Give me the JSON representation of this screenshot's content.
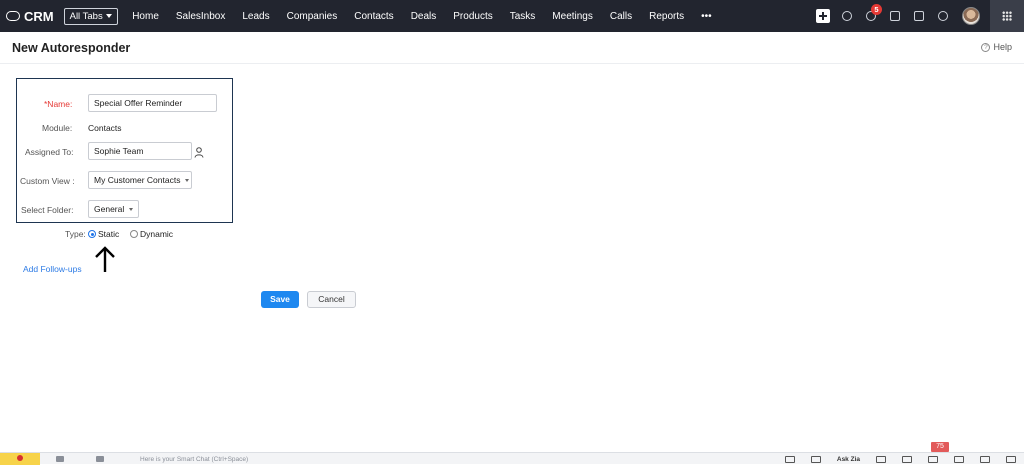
{
  "nav": {
    "brand": "CRM",
    "all_tabs": "All Tabs",
    "items": [
      "Home",
      "SalesInbox",
      "Leads",
      "Companies",
      "Contacts",
      "Deals",
      "Products",
      "Tasks",
      "Meetings",
      "Calls",
      "Reports",
      "•••"
    ],
    "notification_count": "5"
  },
  "page": {
    "title": "New Autoresponder",
    "help": "Help"
  },
  "form": {
    "name_label": "*Name:",
    "name_value": "Special Offer Reminder",
    "module_label": "Module:",
    "module_value": "Contacts",
    "assigned_label": "Assigned To:",
    "assigned_value": "Sophie Team",
    "view_label": "Custom View :",
    "view_value": "My Customer Contacts",
    "folder_label": "Select Folder:",
    "folder_value": "General",
    "type_label": "Type:",
    "type_options": [
      "Static",
      "Dynamic"
    ],
    "type_selected": "Static",
    "add_followups": "Add Follow-ups"
  },
  "actions": {
    "save": "Save",
    "cancel": "Cancel"
  },
  "bottombar": {
    "chat_placeholder": "Here is your Smart Chat (Ctrl+Space)",
    "ask_zia": "Ask Zia",
    "count": "75"
  },
  "colors": {
    "topbar": "#22252f",
    "accent": "#1e88f0",
    "required": "#e53935",
    "highlight_border": "#1e3551"
  }
}
